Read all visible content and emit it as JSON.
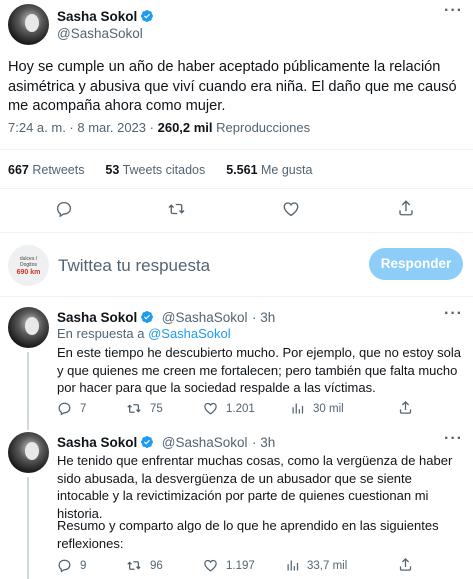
{
  "main_tweet": {
    "author_name": "Sasha Sokol",
    "author_handle": "@SashaSokol",
    "text": "Hoy se cumple un año de haber aceptado públicamente la relación asimétrica y abusiva que viví cuando era niña. El daño que me causó me acompaña ahora como mujer.",
    "time": "7:24 a. m. · 8 mar. 2023",
    "views_count": "260,2 mil",
    "views_label": "Reproducciones",
    "retweets_count": "667",
    "retweets_label": "Retweets",
    "quotes_count": "53",
    "quotes_label": "Tweets citados",
    "likes_count": "5.561",
    "likes_label": "Me gusta"
  },
  "composer": {
    "placeholder": "Twittea tu respuesta",
    "button_label": "Responder",
    "avatar_text_1": "dulces / Dogitos",
    "avatar_text_2": "690 km"
  },
  "replies": [
    {
      "author_name": "Sasha Sokol",
      "author_handle": "@SashaSokol",
      "time": "· 3h",
      "reply_to_prefix": "En respuesta a",
      "reply_to_handle": "@SashaSokol",
      "text": "En este tiempo he descubierto mucho. Por ejemplo, que no estoy sola y que quienes me creen me fortalecen; pero también que falta mucho por hacer para que la sociedad respalde a las víctimas.",
      "replies": "7",
      "retweets": "75",
      "likes": "1.201",
      "views": "30 mil"
    },
    {
      "author_name": "Sasha Sokol",
      "author_handle": "@SashaSokol",
      "time": "· 3h",
      "text": "He tenido que enfrentar muchas cosas, como la vergüenza de haber sido abusada, la desvergüenza de un abusador que se siente intocable y la revictimización por parte de quienes cuestionan mi historia.",
      "text_2": "Resumo y comparto algo de lo que he aprendido en las siguientes reflexiones:",
      "replies": "9",
      "retweets": "96",
      "likes": "1.197",
      "views": "33,7 mil"
    }
  ],
  "colors": {
    "accent": "#1d9bf0",
    "muted": "#536471",
    "text": "#0f1419",
    "button_disabled": "#8ecdf8",
    "separator": "#eff3f4"
  }
}
